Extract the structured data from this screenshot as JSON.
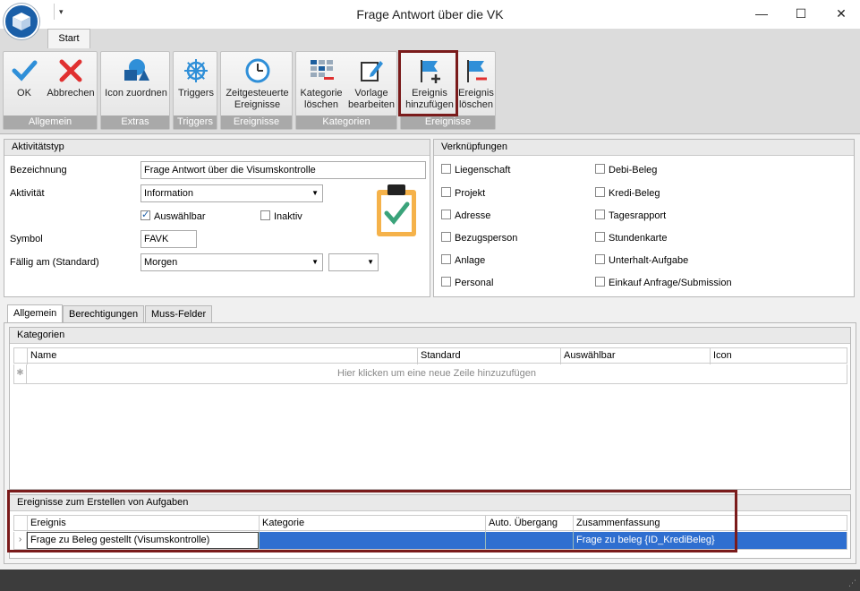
{
  "window": {
    "title": "Frage Antwort über die VK",
    "minimize": "—",
    "maximize": "☐",
    "close": "✕"
  },
  "ribbon": {
    "tab_start": "Start",
    "groups": {
      "allgemein": "Allgemein",
      "extras": "Extras",
      "triggers": "Triggers",
      "ereignisse1": "Ereignisse",
      "kategorien": "Kategorien",
      "ereignisse2": "Ereignisse"
    },
    "buttons": {
      "ok": "OK",
      "abbrechen": "Abbrechen",
      "icon_zuordnen": "Icon zuordnen",
      "triggers": "Triggers",
      "zeitgesteuerte_1": "Zeitgesteuerte",
      "zeitgesteuerte_2": "Ereignisse",
      "kategorie_loeschen_1": "Kategorie",
      "kategorie_loeschen_2": "löschen",
      "vorlage_bearbeiten_1": "Vorlage",
      "vorlage_bearbeiten_2": "bearbeiten",
      "ereignis_hinzufuegen_1": "Ereignis",
      "ereignis_hinzufuegen_2": "hinzufügen",
      "ereignis_loeschen_1": "Ereignis",
      "ereignis_loeschen_2": "löschen"
    },
    "colors": {
      "accent_blue": "#2f8fd8",
      "cancel_red": "#e03030",
      "highlight": "#7a1b1b"
    }
  },
  "aktivitaetstyp": {
    "header": "Aktivitätstyp",
    "bezeichnung_label": "Bezeichnung",
    "bezeichnung_value": "Frage Antwort über die Visumskontrolle",
    "aktivitaet_label": "Aktivität",
    "aktivitaet_value": "Information",
    "auswaehlbar_label": "Auswählbar",
    "auswaehlbar_checked": true,
    "inaktiv_label": "Inaktiv",
    "inaktiv_checked": false,
    "symbol_label": "Symbol",
    "symbol_value": "FAVK",
    "faellig_label": "Fällig am (Standard)",
    "faellig_value": "Morgen",
    "faellig_second_value": ""
  },
  "verknuepfungen": {
    "header": "Verknüpfungen",
    "left": [
      "Liegenschaft",
      "Projekt",
      "Adresse",
      "Bezugsperson",
      "Anlage",
      "Personal"
    ],
    "right": [
      "Debi-Beleg",
      "Kredi-Beleg",
      "Tagesrapport",
      "Stundenkarte",
      "Unterhalt-Aufgabe",
      "Einkauf Anfrage/Submission"
    ]
  },
  "tabs": [
    "Allgemein",
    "Berechtigungen",
    "Muss-Felder"
  ],
  "kategorien": {
    "header": "Kategorien",
    "columns": [
      "Name",
      "Standard",
      "Auswählbar",
      "Icon"
    ],
    "new_row_hint": "Hier klicken um eine neue Zeile hinzuzufügen"
  },
  "ereignisse": {
    "header": "Ereignisse zum Erstellen von Aufgaben",
    "columns": [
      "Ereignis",
      "Kategorie",
      "Auto. Übergang",
      "Zusammenfassung"
    ],
    "rows": [
      {
        "ereignis": "Frage zu Beleg gestellt (Visumskontrolle)",
        "kategorie": "",
        "auto": "",
        "zusammenfassung": "Frage zu beleg {ID_KrediBeleg}"
      }
    ],
    "selection_color": "#2f6fd0"
  }
}
